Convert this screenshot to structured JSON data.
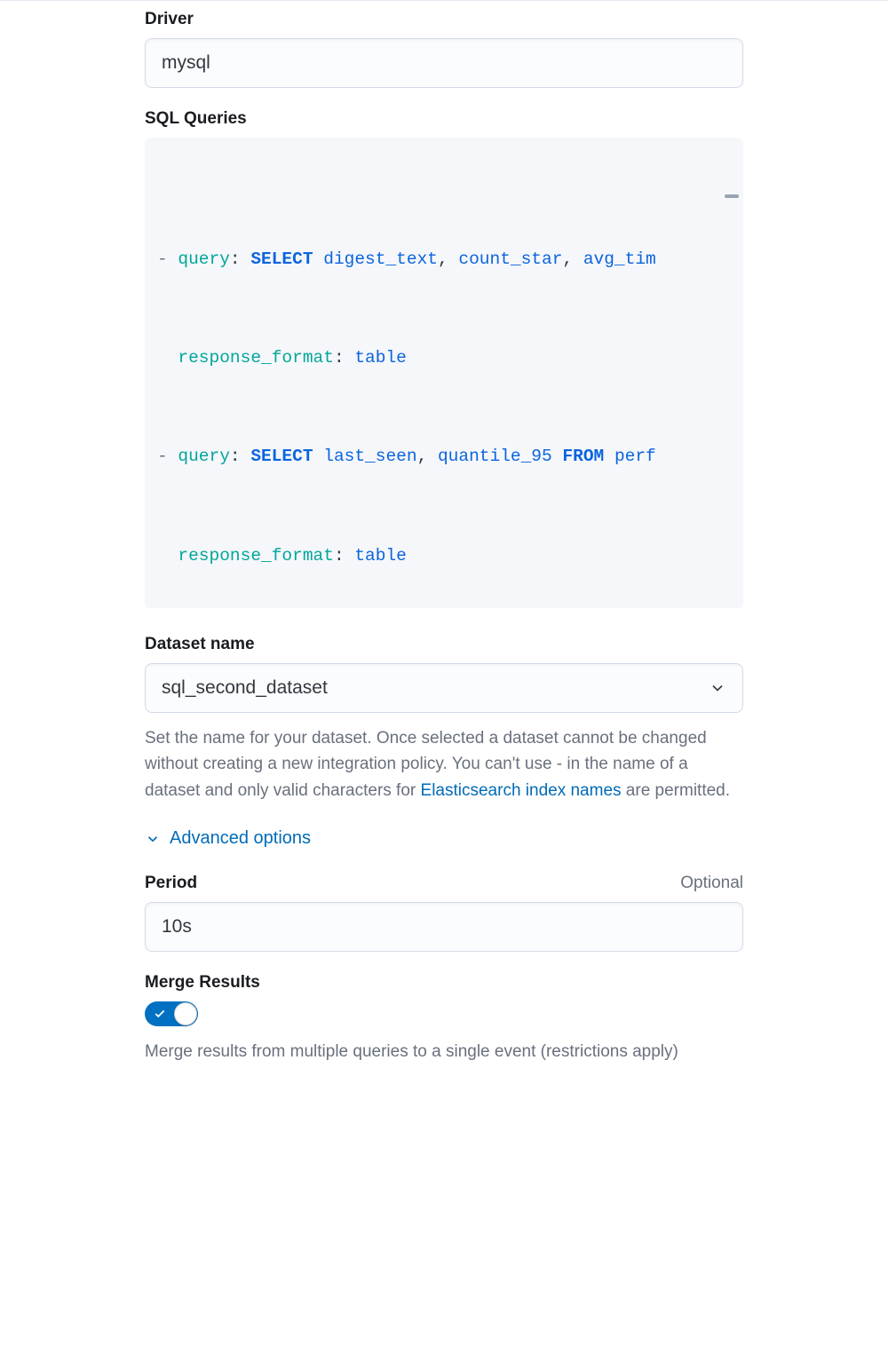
{
  "driver": {
    "label": "Driver",
    "value": "mysql"
  },
  "sql_queries": {
    "label": "SQL Queries",
    "lines": [
      {
        "dash": "- ",
        "key": "query",
        "colon": ": ",
        "kw": "SELECT",
        "sp": " ",
        "id1": "digest_text",
        "c1": ", ",
        "id2": "count_star",
        "c2": ", ",
        "id3": "avg_tim"
      },
      {
        "indent": "  ",
        "key": "response_format",
        "colon": ": ",
        "val": "table"
      },
      {
        "dash": "- ",
        "key": "query",
        "colon": ": ",
        "kw": "SELECT",
        "sp": " ",
        "id1": "last_seen",
        "c1": ", ",
        "id2": "quantile_95",
        "sp2": " ",
        "kw2": "FROM",
        "sp3": " ",
        "id3": "perf"
      },
      {
        "indent": "  ",
        "key": "response_format",
        "colon": ": ",
        "val": "table"
      }
    ]
  },
  "dataset": {
    "label": "Dataset name",
    "value": "sql_second_dataset",
    "help_pre": "Set the name for your dataset. Once selected a dataset cannot be changed without creating a new integration policy. You can't use - in the name of a dataset and only valid characters for ",
    "help_link": "Elasticsearch index names",
    "help_post": " are permitted."
  },
  "advanced": {
    "label": "Advanced options"
  },
  "period": {
    "label": "Period",
    "optional": "Optional",
    "value": "10s"
  },
  "merge": {
    "label": "Merge Results",
    "enabled": true,
    "help": "Merge results from multiple queries to a single event (restrictions apply)"
  }
}
